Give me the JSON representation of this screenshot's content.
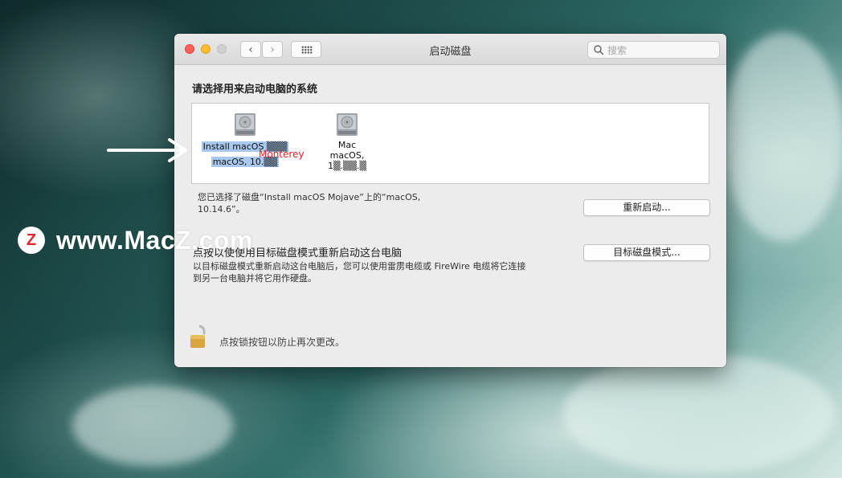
{
  "window": {
    "title": "启动磁盘",
    "search_placeholder": "搜索"
  },
  "main": {
    "section_title": "请选择用来启动电脑的系统",
    "disks": [
      {
        "name": "Install macOS ▒▒▒",
        "sub": "macOS, 10.▒▒",
        "selected": true
      },
      {
        "name": "Mac",
        "sub": "macOS, 1▒.▒▒.▒"
      }
    ],
    "annotation": "Monterey",
    "selected_text": "您已选择了磁盘“Install macOS Mojave”上的“macOS, 10.14.6”。",
    "restart_button": "重新启动...",
    "target_mode_title": "点按以使使用目标磁盘模式重新启动这台电脑",
    "target_mode_desc": "以目标磁盘模式重新启动这台电脑后，您可以使用雷雳电缆或 FireWire 电缆将它连接到另一台电脑并将它用作硬盘。",
    "target_mode_button": "目标磁盘模式...",
    "lock_text": "点按锁按钮以防止再次更改。"
  },
  "watermark": {
    "logo_letter": "Z",
    "text": "www.MacZ.com"
  },
  "colors": {
    "close": "#fe5f57",
    "minimize": "#febc2e",
    "selection": "#a9c8ee",
    "annotation": "#e0202a"
  }
}
